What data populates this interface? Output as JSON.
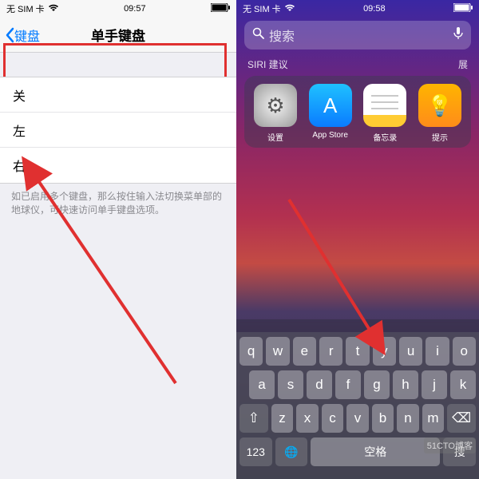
{
  "left": {
    "status": {
      "carrier": "无 SIM 卡",
      "time": "09:57"
    },
    "nav": {
      "back": "键盘",
      "title": "单手键盘"
    },
    "options": [
      "关",
      "左",
      "右"
    ],
    "footer": "如已启用多个键盘，那么按住输入法切换菜单部的地球仪，可快速访问单手键盘选项。"
  },
  "right": {
    "status": {
      "carrier": "无 SIM 卡",
      "time": "09:58"
    },
    "search": {
      "placeholder": "搜索"
    },
    "siri": {
      "label": "SIRI 建议",
      "more": "展"
    },
    "apps": [
      {
        "name": "设置",
        "icon": "gear-icon",
        "cls": "ic-settings",
        "glyph": "⚙"
      },
      {
        "name": "App Store",
        "icon": "appstore-icon",
        "cls": "ic-appstore",
        "glyph": "A"
      },
      {
        "name": "备忘录",
        "icon": "notes-icon",
        "cls": "ic-notes",
        "glyph": ""
      },
      {
        "name": "提示",
        "icon": "tips-icon",
        "cls": "ic-tips",
        "glyph": "💡"
      }
    ],
    "keyboard": {
      "row1": [
        "q",
        "w",
        "e",
        "r",
        "t",
        "y",
        "u",
        "i",
        "o"
      ],
      "row2": [
        "a",
        "s",
        "d",
        "f",
        "g",
        "h",
        "j",
        "k"
      ],
      "row3_shift": "⇧",
      "row3": [
        "z",
        "x",
        "c",
        "v",
        "b",
        "n",
        "m"
      ],
      "row3_del": "⌫",
      "row4": {
        "num": "123",
        "globe": "🌐",
        "space": "空格",
        "ret": "搜"
      }
    },
    "watermark": "51CTO博客"
  }
}
